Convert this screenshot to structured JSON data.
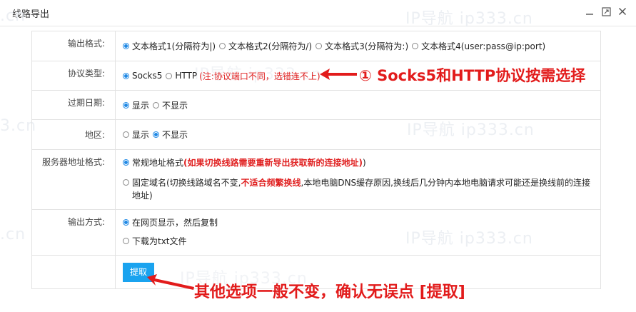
{
  "window": {
    "title": "线路导出"
  },
  "watermarks": [
    "IP导航 ip333.cn",
    "IP导航 ip333.cn",
    "IP导航 ip333.cn",
    "IP导航 ip333.cn",
    "IP导航 ip333.cn",
    ".cn",
    ".cn",
    "3.cn"
  ],
  "rows": {
    "format": {
      "label": "输出格式:",
      "options": [
        {
          "label": "文本格式1(分隔符为|)",
          "checked": true
        },
        {
          "label": "文本格式2(分隔符为/)",
          "checked": false
        },
        {
          "label": "文本格式3(分隔符为:)",
          "checked": false
        },
        {
          "label": "文本格式4(user:pass@ip:port)",
          "checked": false
        }
      ]
    },
    "protocol": {
      "label": "协议类型:",
      "options": [
        {
          "label": "Socks5",
          "checked": true
        },
        {
          "label": "HTTP",
          "checked": false
        }
      ],
      "note": "(注:协议端口不同，选错连不上)"
    },
    "expire": {
      "label": "过期日期:",
      "options": [
        {
          "label": "显示",
          "checked": true
        },
        {
          "label": "不显示",
          "checked": false
        }
      ]
    },
    "region": {
      "label": "地区:",
      "options": [
        {
          "label": "显示",
          "checked": false
        },
        {
          "label": "不显示",
          "checked": true
        }
      ]
    },
    "server": {
      "label": "服务器地址格式:",
      "opt1": {
        "label": "常规地址格式",
        "note": "(如果切换线路需要重新导出获取新的连接地址)",
        "close": ")",
        "checked": true
      },
      "opt2": {
        "label": "固定域名(切换线路域名不变,",
        "red": "不适合频繁换线",
        "rest": ",本地电脑DNS缓存原因,换线后几分钟内本地电脑请求可能还是换线前的连接地址)",
        "checked": false
      }
    },
    "output": {
      "label": "输出方式:",
      "options": [
        {
          "label": "在网页显示，然后复制",
          "checked": true
        },
        {
          "label": "下载为txt文件",
          "checked": false
        }
      ]
    }
  },
  "extract_button": "提取",
  "annotations": {
    "protocol_tip": "① Socks5和HTTP协议按需选择",
    "extract_tip": "其他选项一般不变，确认无误点 [提取]"
  },
  "colors": {
    "accent": "#1aa3ef",
    "radio": "#1e88e5",
    "annotation": "#e21b1b"
  }
}
